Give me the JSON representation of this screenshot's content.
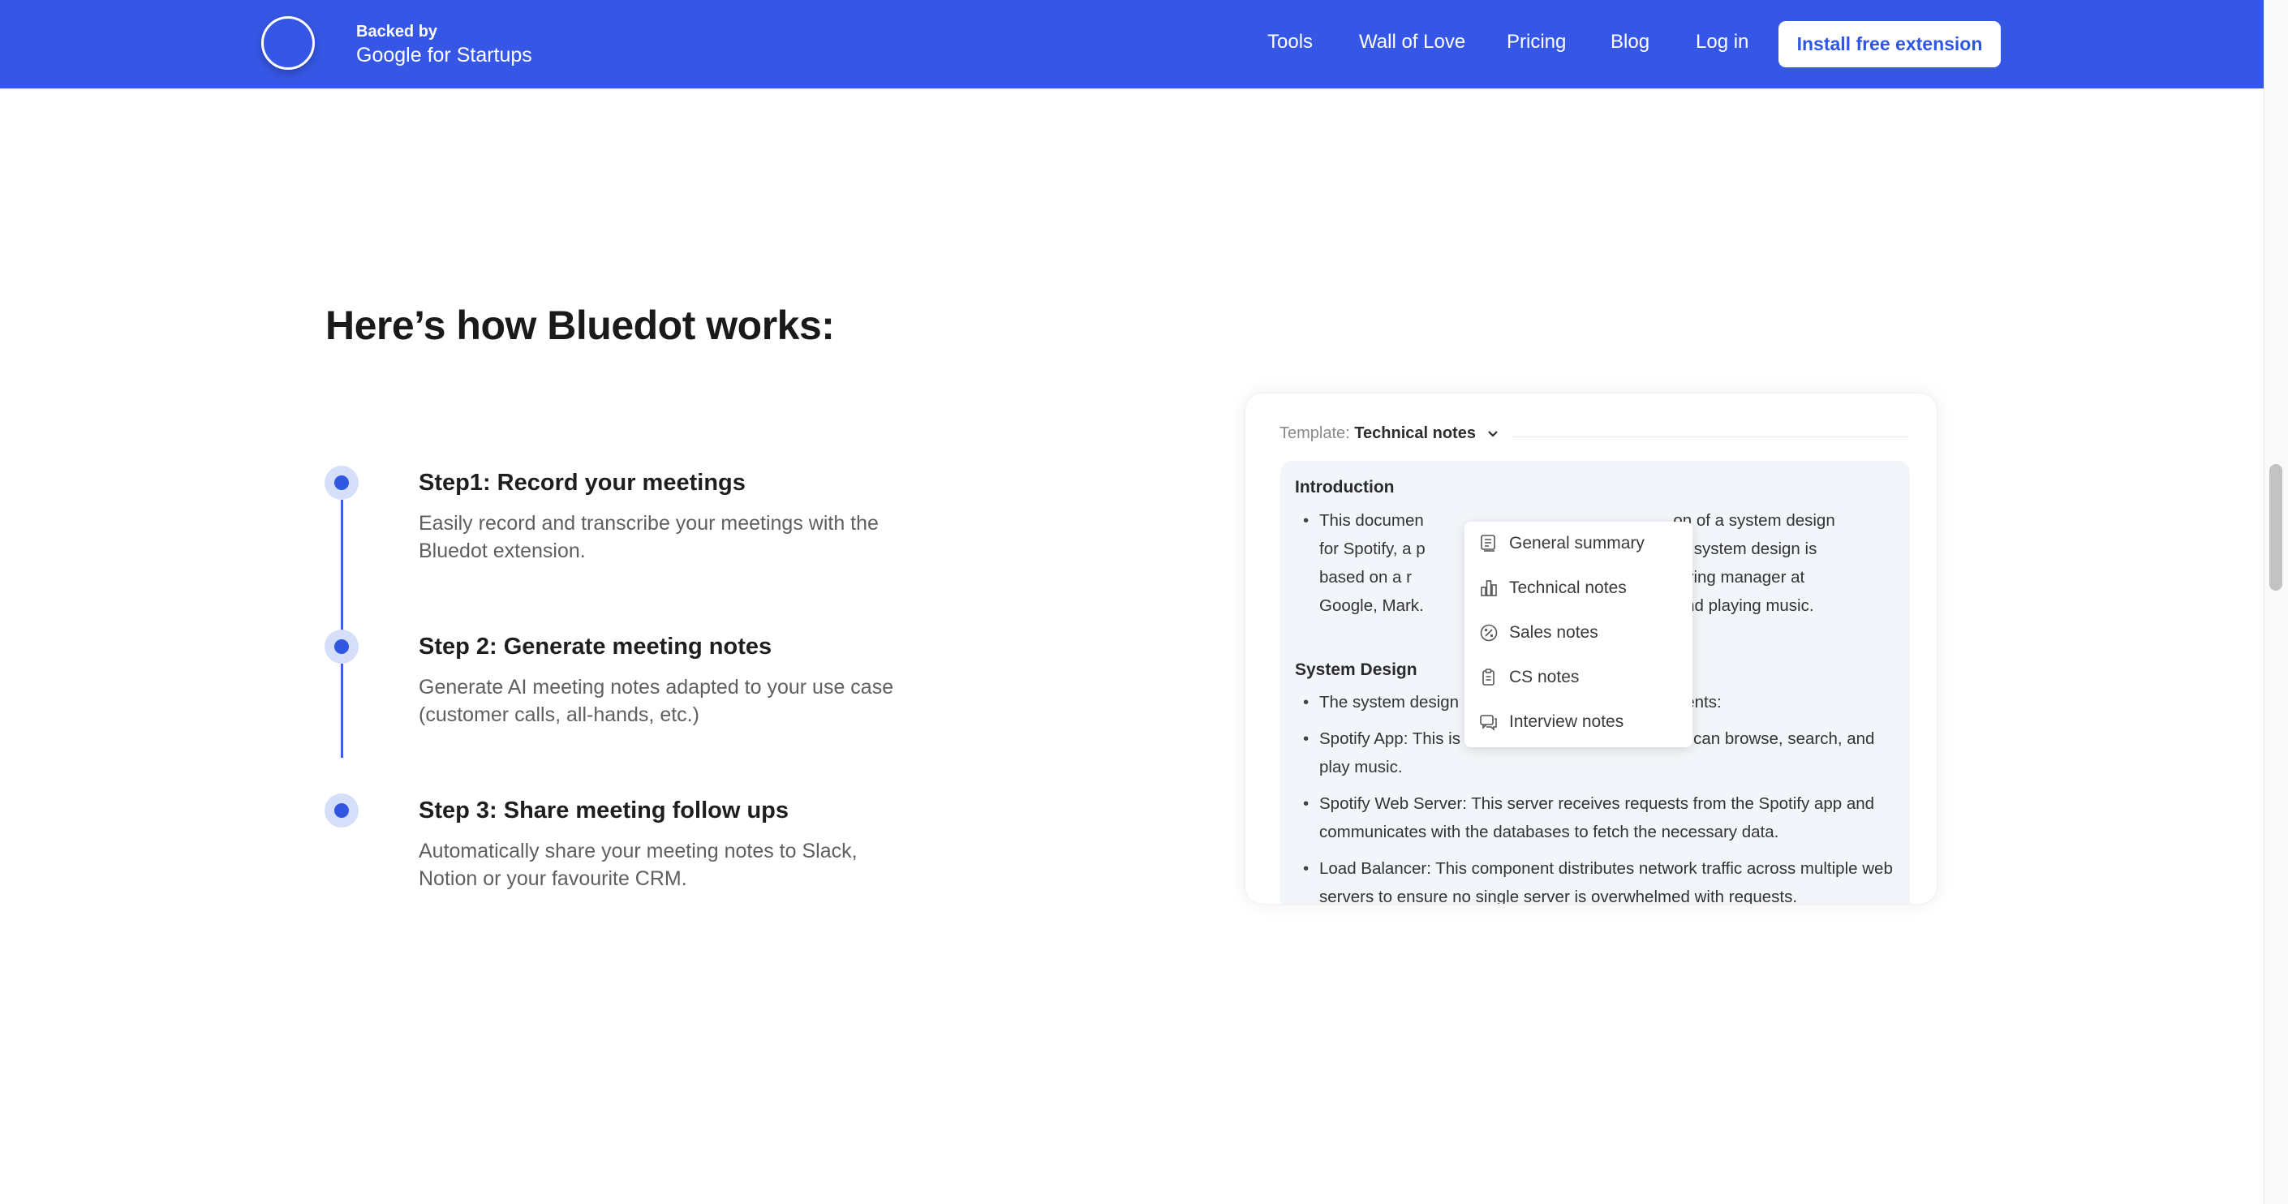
{
  "header": {
    "backed_by": "Backed by",
    "google_word": "Google",
    "for_startups": "for Startups",
    "nav": [
      "Tools",
      "Wall of Love",
      "Pricing",
      "Blog",
      "Log in"
    ],
    "install_label": "Install free extension"
  },
  "section": {
    "title": "Here’s how Bluedot works:",
    "steps": [
      {
        "title": "Step1: Record your meetings",
        "desc": "Easily record and transcribe your meetings with the Bluedot extension."
      },
      {
        "title": "Step 2: Generate meeting notes",
        "desc": "Generate AI meeting notes adapted to your use case (customer calls, all-hands, etc.)"
      },
      {
        "title": "Step 3: Share meeting follow ups",
        "desc": "Automatically share your meeting notes to Slack, Notion or your favourite CRM."
      }
    ]
  },
  "card": {
    "template_label": "Template:",
    "template_value": "Technical notes",
    "intro_heading": "Introduction",
    "intro_text": "This documen                                                      on of a system design for Spotify, a p                                               e. The system design is based on a r                                               engineering manager at Google, Mark.                                            inding and playing music.",
    "system_heading": "System Design",
    "bullets": [
      "The system design includes the following components:",
      "Spotify App: This is the user interface where users can browse, search, and play music.",
      "Spotify Web Server: This server receives requests from the Spotify app and communicates with the databases to fetch the necessary data.",
      "Load Balancer: This component distributes network traffic across multiple web servers to ensure no single server is overwhelmed with requests."
    ],
    "menu": [
      {
        "label": "General summary",
        "icon": "document-lines-icon"
      },
      {
        "label": "Technical notes",
        "icon": "bar-chart-icon"
      },
      {
        "label": "Sales notes",
        "icon": "percent-badge-icon"
      },
      {
        "label": "CS notes",
        "icon": "clipboard-copy-icon"
      },
      {
        "label": "Interview notes",
        "icon": "chat-bubbles-icon"
      }
    ]
  },
  "colors": {
    "brand_blue": "#3657e6",
    "timeline_blue": "#3157e0",
    "dot_halo": "#d6dff9"
  }
}
